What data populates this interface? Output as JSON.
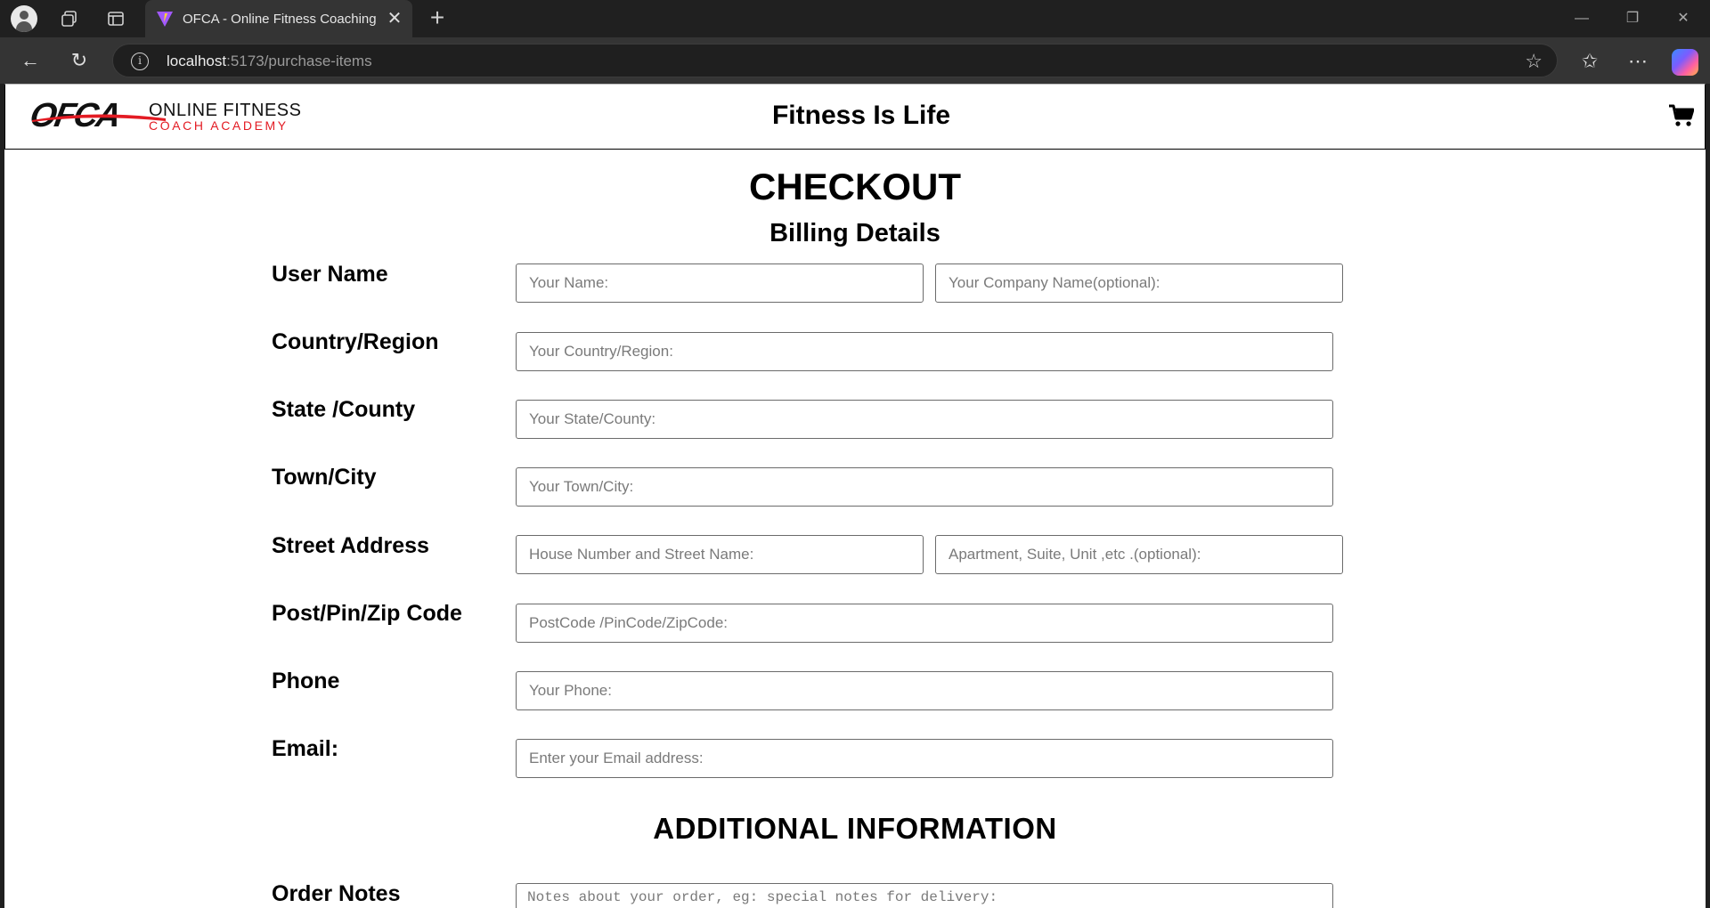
{
  "browser": {
    "tab_title": "OFCA - Online Fitness Coaching Academy",
    "tab_close": "✕",
    "new_tab": "+",
    "url_host": "localhost",
    "url_path": ":5173/purchase-items"
  },
  "header": {
    "logo_mark": "OFCA",
    "logo_line1": "ONLINE FITNESS",
    "logo_line2": "COACH ACADEMY",
    "site_title": "Fitness Is Life",
    "accent_color": "#e31b23"
  },
  "checkout": {
    "title": "CHECKOUT",
    "subtitle": "Billing Details",
    "labels": {
      "user_name": "User Name",
      "country": "Country/Region",
      "state": "State /County",
      "town": "Town/City",
      "street": "Street Address",
      "postcode": "Post/Pin/Zip Code",
      "phone": "Phone",
      "email": "Email:"
    },
    "placeholders": {
      "name": "Your Name:",
      "company": "Your Company Name(optional):",
      "country": "Your Country/Region:",
      "state": "Your State/County:",
      "town": "Your Town/City:",
      "street1": "House Number and Street Name:",
      "street2": "Apartment, Suite, Unit ,etc .(optional):",
      "postcode": "PostCode /PinCode/ZipCode:",
      "phone": "Your Phone:",
      "email": "Enter your Email address:"
    }
  },
  "additional": {
    "title": "ADDITIONAL INFORMATION",
    "order_notes_label": "Order Notes",
    "order_notes_placeholder": "Notes about your order, eg: special notes for delivery:"
  }
}
